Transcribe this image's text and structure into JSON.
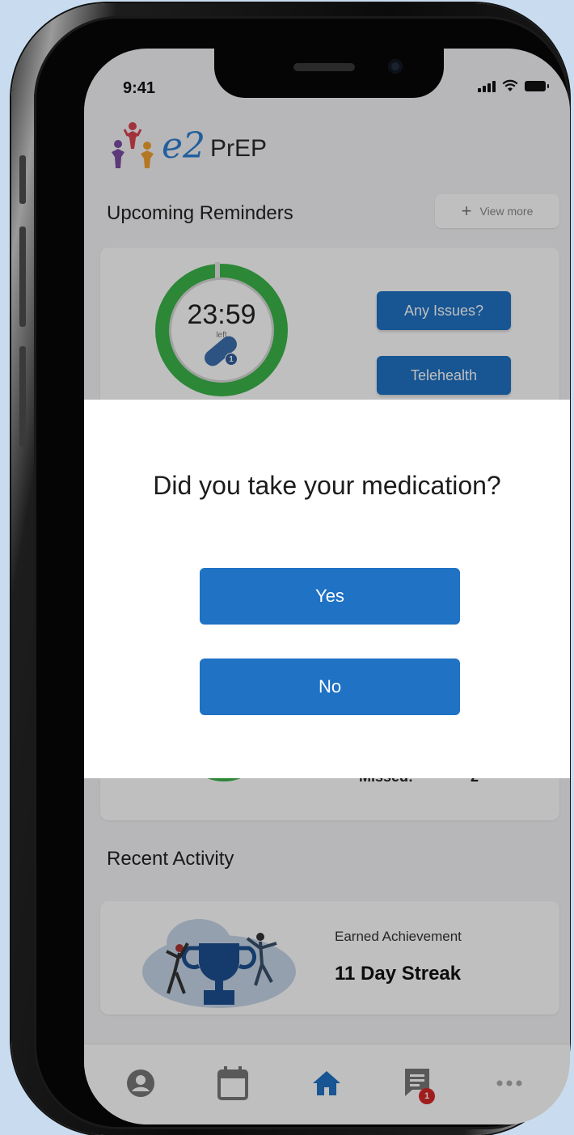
{
  "status_bar": {
    "time": "9:41"
  },
  "header": {
    "logo_e2": "e2",
    "logo_prep": "PrEP"
  },
  "reminders": {
    "title": "Upcoming Reminders",
    "view_more_label": "View more",
    "timer": {
      "value": "23:59",
      "sublabel": "left",
      "dose_badge": "1"
    },
    "any_issues_label": "Any Issues?",
    "telehealth_label": "Telehealth",
    "missed_label": "Missed:",
    "missed_value": "2"
  },
  "modal": {
    "question": "Did you take your medication?",
    "yes_label": "Yes",
    "no_label": "No"
  },
  "recent_activity": {
    "title": "Recent Activity",
    "item": {
      "label": "Earned Achievement",
      "value": "11 Day Streak"
    }
  },
  "tabbar": {
    "items": [
      "profile-icon",
      "calendar-icon",
      "home-icon",
      "messages-icon",
      "more-icon"
    ],
    "active": "home-icon",
    "messages_badge": "1"
  },
  "colors": {
    "primary": "#1f72c4",
    "ring": "#3bb54a",
    "badge": "#d62728",
    "background": "#c9dcef"
  }
}
